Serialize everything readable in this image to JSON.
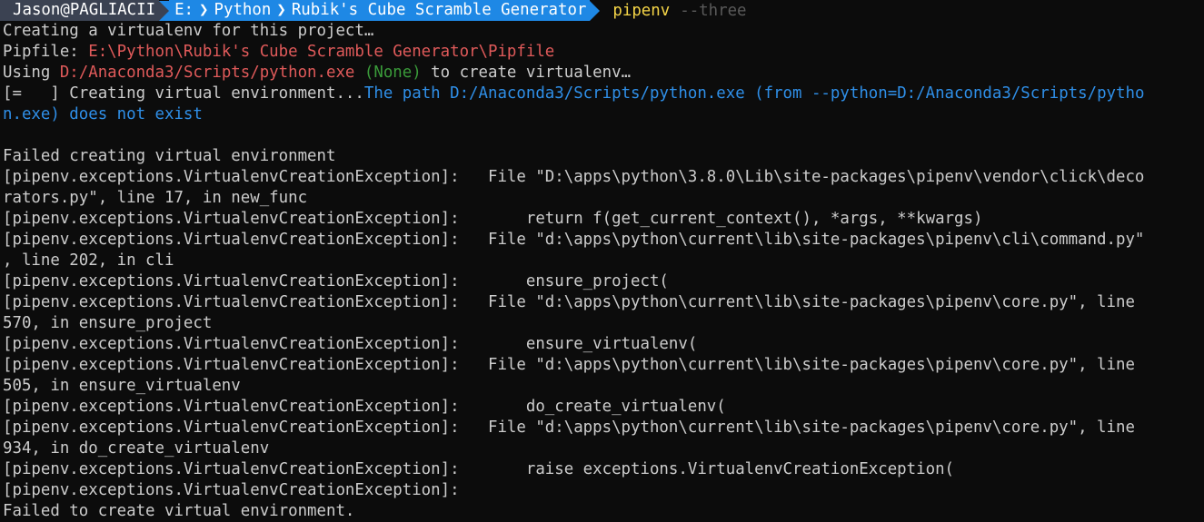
{
  "prompt": {
    "user": "Jason@PAGLIACII",
    "path": [
      "E:",
      "Python",
      "Rubik's Cube Scramble Generator"
    ],
    "path_separator": "❯",
    "command": "pipenv",
    "argument": "--three"
  },
  "lines": {
    "l1": "Creating a virtualenv for this project…",
    "l2_label": "Pipfile: ",
    "l2_path": "E:\\Python\\Rubik's Cube Scramble Generator\\Pipfile",
    "l3_a": "Using ",
    "l3_path": "D:/Anaconda3/Scripts/python.exe",
    "l3_none": " (None)",
    "l3_b": " to create virtualenv…",
    "l4_a": "[=   ] Creating virtual environment...",
    "l4_b": "The path D:/Anaconda3/Scripts/python.exe (from --python=D:/Anaconda3/Scripts/pytho",
    "l5": "n.exe) does not exist",
    "l6": "",
    "l7": "Failed creating virtual environment",
    "l8": "[pipenv.exceptions.VirtualenvCreationException]:   File \"D:\\apps\\python\\3.8.0\\Lib\\site-packages\\pipenv\\vendor\\click\\deco",
    "l9": "rators.py\", line 17, in new_func",
    "l10": "[pipenv.exceptions.VirtualenvCreationException]:       return f(get_current_context(), *args, **kwargs)",
    "l11": "[pipenv.exceptions.VirtualenvCreationException]:   File \"d:\\apps\\python\\current\\lib\\site-packages\\pipenv\\cli\\command.py\"",
    "l12": ", line 202, in cli",
    "l13": "[pipenv.exceptions.VirtualenvCreationException]:       ensure_project(",
    "l14": "[pipenv.exceptions.VirtualenvCreationException]:   File \"d:\\apps\\python\\current\\lib\\site-packages\\pipenv\\core.py\", line",
    "l15": "570, in ensure_project",
    "l16": "[pipenv.exceptions.VirtualenvCreationException]:       ensure_virtualenv(",
    "l17": "[pipenv.exceptions.VirtualenvCreationException]:   File \"d:\\apps\\python\\current\\lib\\site-packages\\pipenv\\core.py\", line",
    "l18": "505, in ensure_virtualenv",
    "l19": "[pipenv.exceptions.VirtualenvCreationException]:       do_create_virtualenv(",
    "l20": "[pipenv.exceptions.VirtualenvCreationException]:   File \"d:\\apps\\python\\current\\lib\\site-packages\\pipenv\\core.py\", line",
    "l21": "934, in do_create_virtualenv",
    "l22": "[pipenv.exceptions.VirtualenvCreationException]:       raise exceptions.VirtualenvCreationException(",
    "l23": "[pipenv.exceptions.VirtualenvCreationException]:",
    "l24": "Failed to create virtual environment."
  },
  "colors": {
    "background": "#0c0c0c",
    "text": "#cccccc",
    "prompt_user_bg": "#3b4252",
    "prompt_path_bg": "#1e88e5",
    "command": "#f5d547",
    "error_path": "#e05a5a",
    "info_blue": "#2f8fe8",
    "none_green": "#3a9b3a"
  }
}
